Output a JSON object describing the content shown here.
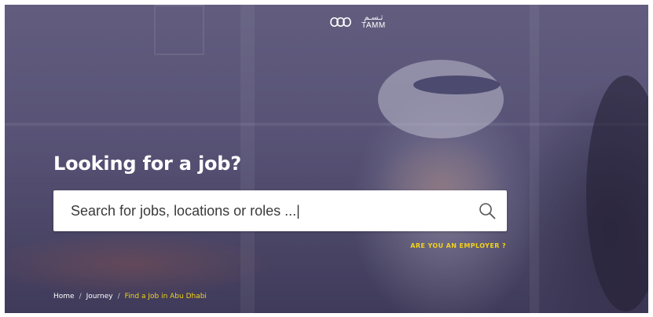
{
  "header": {
    "logo_ar": "تـسـم",
    "logo_en": "TAMM"
  },
  "hero": {
    "title": "Looking for a job?"
  },
  "search": {
    "placeholder": "Search for jobs, locations or roles ...|"
  },
  "employer_link": "ARE YOU AN EMPLOYER ?",
  "breadcrumb": {
    "items": [
      "Home",
      "Journey",
      "Find a Job in Abu Dhabi"
    ],
    "separator": "/"
  },
  "colors": {
    "accent": "#f2d21b",
    "overlay": "#5f5b78",
    "text": "#ffffff"
  },
  "icons": {
    "logo": "tamm-logo-icon",
    "search": "search-icon"
  }
}
